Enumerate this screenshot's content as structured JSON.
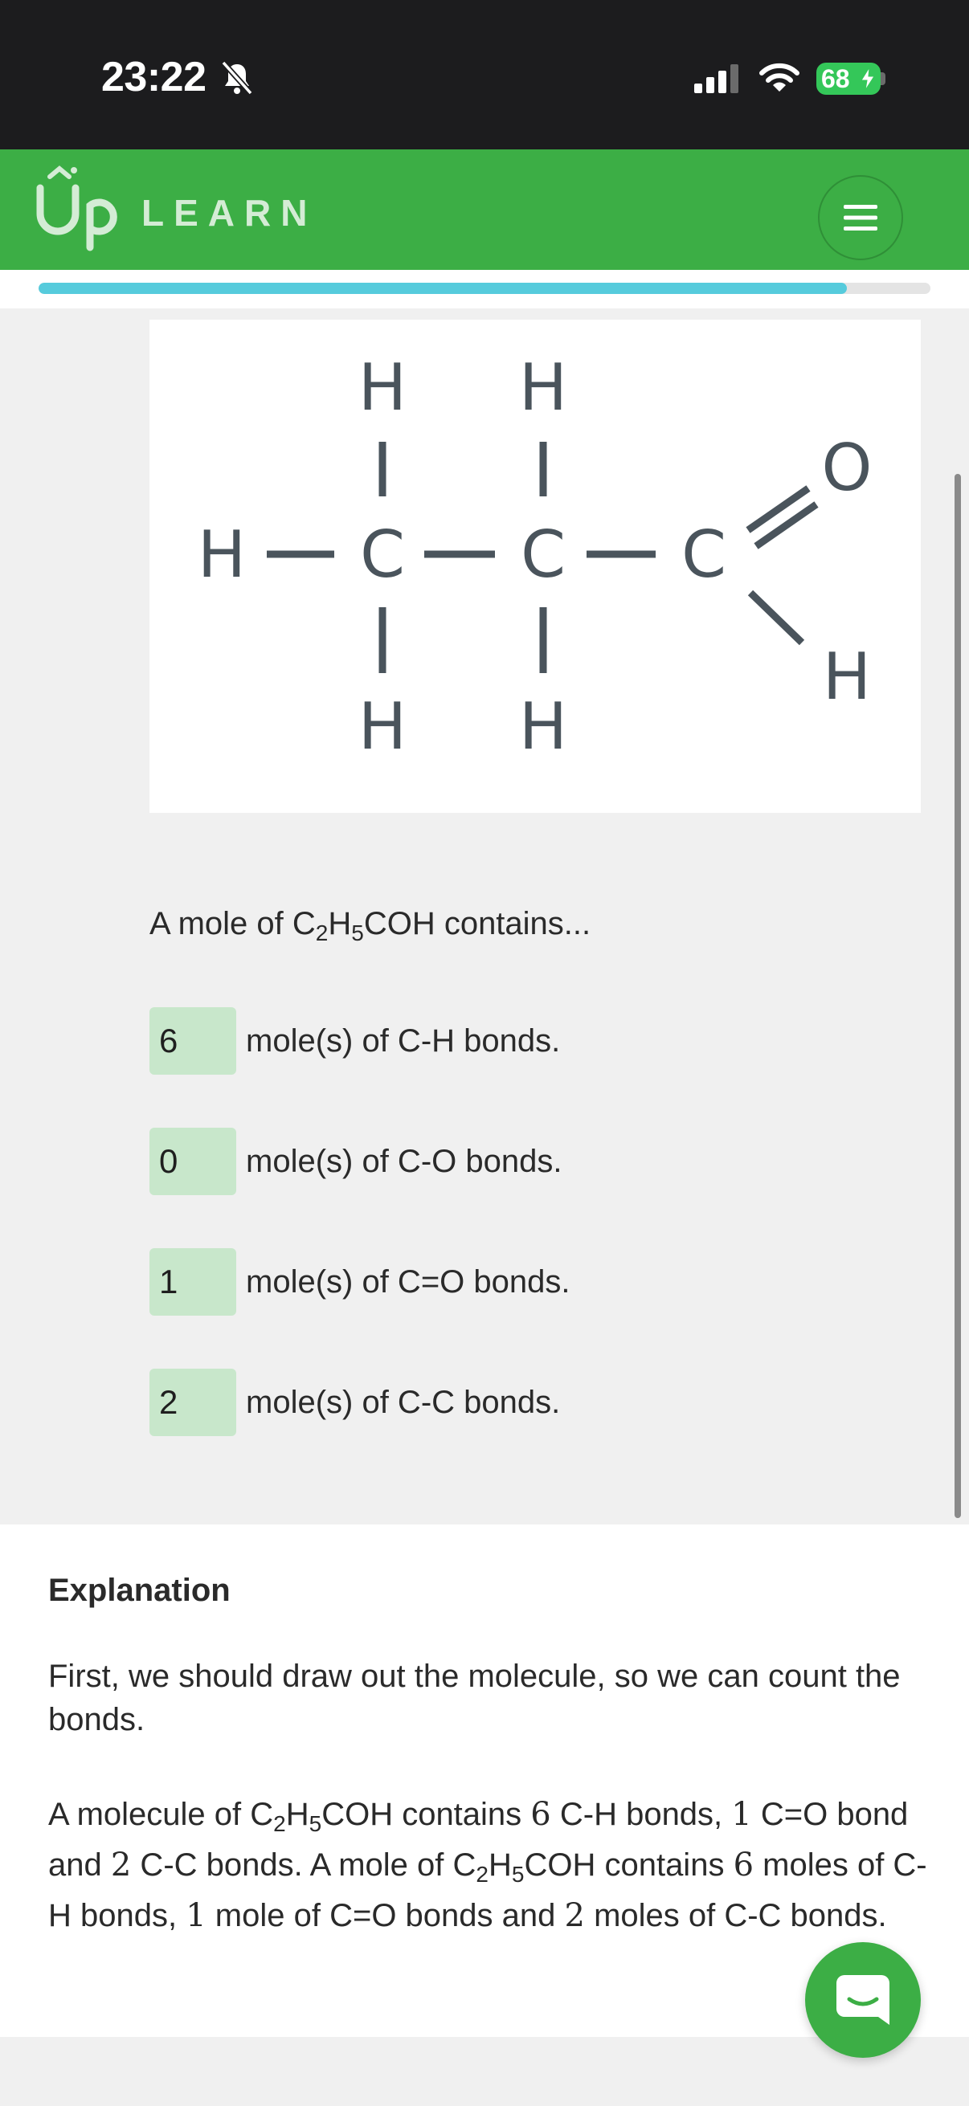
{
  "status_bar": {
    "time": "23:22",
    "battery": "68"
  },
  "header": {
    "logo_text": "LEARN"
  },
  "progress": {
    "fraction": 0.906
  },
  "diagram": {
    "atoms": [
      "H",
      "H",
      "H",
      "C",
      "C",
      "C",
      "O",
      "H",
      "H",
      "H"
    ]
  },
  "question": {
    "prefix": "A mole of ",
    "formula": {
      "a": "C",
      "a_sub": "2",
      "b": "H",
      "b_sub": "5",
      "c": "COH"
    },
    "suffix": " contains..."
  },
  "answers": [
    {
      "value": "6",
      "label": "mole(s) of C-H bonds."
    },
    {
      "value": "0",
      "label": "mole(s) of C-O bonds."
    },
    {
      "value": "1",
      "label": "mole(s) of C=O bonds."
    },
    {
      "value": "2",
      "label": "mole(s) of C-C bonds."
    }
  ],
  "explanation": {
    "title": "Explanation",
    "p1": "First, we should draw out the molecule, so we can count the bonds.",
    "p2": {
      "t1": "A molecule of ",
      "t2": " contains ",
      "n6": "6",
      "t3": " C-H bonds, ",
      "n1": "1",
      "t4": " C=O bond and ",
      "n2": "2",
      "t5": " C-C bonds. A mole of ",
      "t6": " contains ",
      "t7": " moles of C-H bonds, ",
      "t8": " mole of C=O bonds and ",
      "t9": " moles of C-C bonds."
    }
  }
}
